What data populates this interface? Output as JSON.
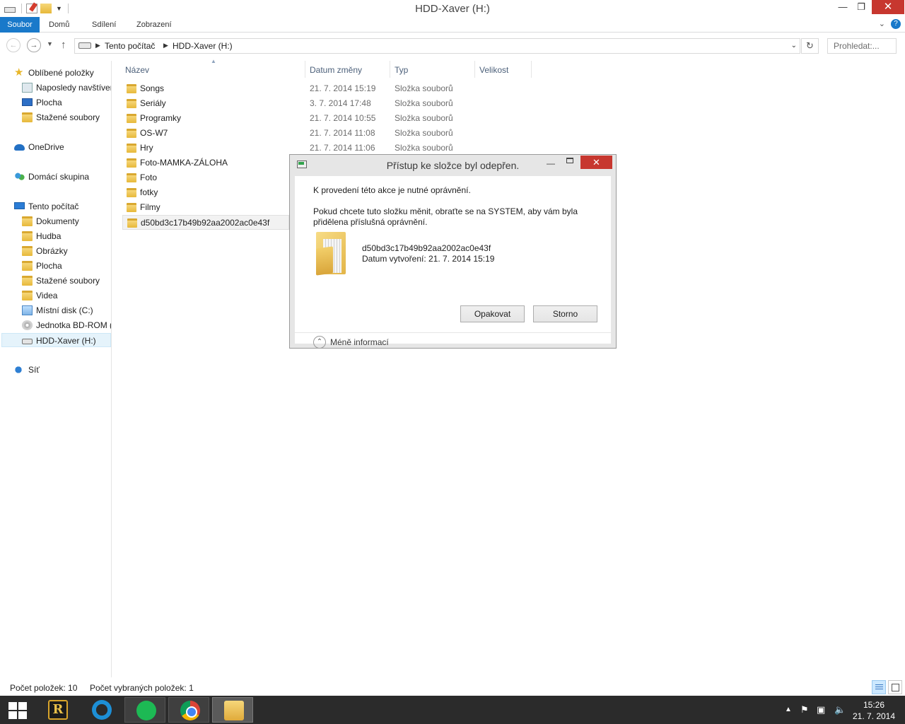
{
  "window": {
    "title": "HDD-Xaver (H:)",
    "minimize_glyph": "—",
    "maximize_glyph": "❐",
    "close_glyph": "✕"
  },
  "ribbon": {
    "tabs": [
      "Soubor",
      "Domů",
      "Sdílení",
      "Zobrazení"
    ],
    "accent_color": "#1979ca"
  },
  "address": {
    "crumbs": [
      "Tento počítač",
      "HDD-Xaver (H:)"
    ],
    "search_placeholder": "Prohledat:..."
  },
  "sidebar": {
    "favorites": {
      "label": "Oblíbené položky",
      "items": [
        "Naposledy navštívené",
        "Plocha",
        "Stažené soubory"
      ]
    },
    "onedrive": "OneDrive",
    "homegroup": "Domácí skupina",
    "this_pc": {
      "label": "Tento počítač",
      "items": [
        "Dokumenty",
        "Hudba",
        "Obrázky",
        "Plocha",
        "Stažené soubory",
        "Videa",
        "Místní disk (C:)",
        "Jednotka BD-ROM (E:)",
        "HDD-Xaver (H:)"
      ]
    },
    "network": "Síť"
  },
  "columns": {
    "name": "Název",
    "date": "Datum změny",
    "type": "Typ",
    "size": "Velikost"
  },
  "files": [
    {
      "name": "Songs",
      "date": "21. 7. 2014 15:19",
      "type": "Složka souborů"
    },
    {
      "name": "Seriály",
      "date": "3. 7. 2014 17:48",
      "type": "Složka souborů"
    },
    {
      "name": "Programky",
      "date": "21. 7. 2014 10:55",
      "type": "Složka souborů"
    },
    {
      "name": "OS-W7",
      "date": "21. 7. 2014 11:08",
      "type": "Složka souborů"
    },
    {
      "name": "Hry",
      "date": "21. 7. 2014 11:06",
      "type": "Složka souborů"
    },
    {
      "name": "Foto-MAMKA-ZÁLOHA",
      "date": "",
      "type": ""
    },
    {
      "name": "Foto",
      "date": "",
      "type": ""
    },
    {
      "name": "fotky",
      "date": "",
      "type": ""
    },
    {
      "name": "Filmy",
      "date": "",
      "type": ""
    },
    {
      "name": "d50bd3c17b49b92aa2002ac0e43f",
      "date": "",
      "type": ""
    }
  ],
  "status": {
    "count": "Počet položek: 10",
    "selected": "Počet vybraných položek: 1"
  },
  "dialog": {
    "title": "Přístup ke složce byl odepřen.",
    "line1": "K provedení této akce je nutné oprávnění.",
    "line2a": "Pokud chcete tuto složku měnit, obraťte se na SYSTEM, aby vám byla",
    "line2b": "přidělena příslušná oprávnění.",
    "folder_name": "d50bd3c17b49b92aa2002ac0e43f",
    "folder_created": "Datum vytvoření: 21. 7. 2014 15:19",
    "retry_label": "Opakovat",
    "cancel_label": "Storno",
    "less_info": "Méně informací",
    "close_color": "#c7372f"
  },
  "taskbar": {
    "apps": [
      "start-icon",
      "r-app-icon",
      "ccleaner-icon",
      "spotify-icon",
      "chrome-icon",
      "file-explorer-icon"
    ],
    "time": "15:26",
    "date": "21. 7. 2014"
  }
}
